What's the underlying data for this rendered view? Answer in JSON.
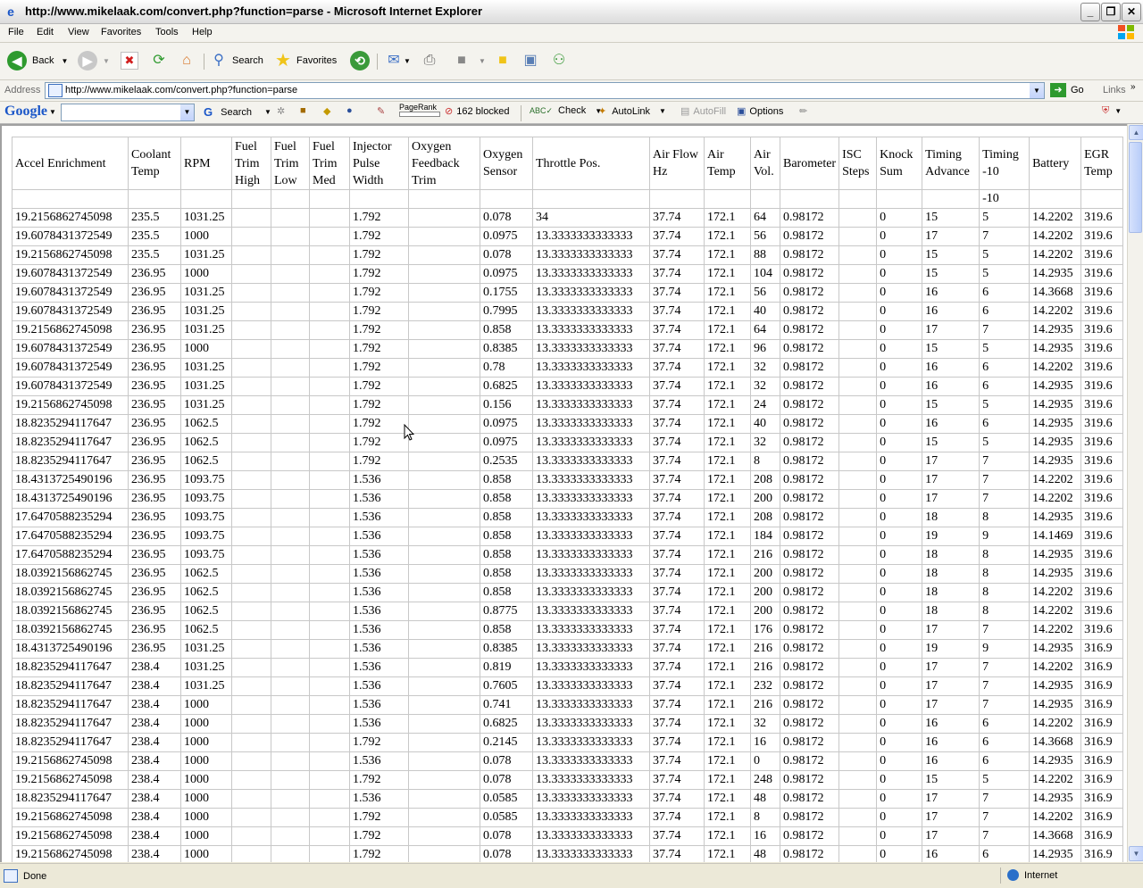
{
  "window": {
    "title": "http://www.mikelaak.com/convert.php?function=parse - Microsoft Internet Explorer"
  },
  "menu": [
    "File",
    "Edit",
    "View",
    "Favorites",
    "Tools",
    "Help"
  ],
  "toolbar": {
    "back": "Back",
    "search": "Search",
    "favorites": "Favorites"
  },
  "address": {
    "label": "Address",
    "url": "http://www.mikelaak.com/convert.php?function=parse",
    "go": "Go",
    "links": "Links"
  },
  "googlebar": {
    "brand": "Google",
    "search": "Search",
    "pagerank": "PageRank",
    "blocked": "162 blocked",
    "check": "Check",
    "autolink": "AutoLink",
    "autofill": "AutoFill",
    "options": "Options"
  },
  "status": {
    "text": "Done",
    "zone": "Internet"
  },
  "table": {
    "headers": [
      "Accel Enrichment",
      "Coolant Temp",
      "RPM",
      "Fuel Trim High",
      "Fuel Trim Low",
      "Fuel Trim Med",
      "Injector Pulse Width",
      "Oxygen Feedback Trim",
      "Oxygen Sensor",
      "Throttle Pos.",
      "Air Flow Hz",
      "Air Temp",
      "Air Vol.",
      "Barometer",
      "ISC Steps",
      "Knock Sum",
      "Timing Advance",
      "Timing -10",
      "Battery",
      "EGR Temp"
    ],
    "rows": [
      [
        "",
        "",
        "",
        "",
        "",
        "",
        "",
        "",
        "",
        "",
        "",
        "",
        "",
        "",
        "",
        "",
        "",
        "-10",
        "",
        ""
      ],
      [
        "19.2156862745098",
        "235.5",
        "1031.25",
        "",
        "",
        "",
        "1.792",
        "",
        "0.078",
        "34",
        "37.74",
        "172.1",
        "64",
        "0.98172",
        "",
        "0",
        "15",
        "5",
        "14.2202",
        "319.6"
      ],
      [
        "19.6078431372549",
        "235.5",
        "1000",
        "",
        "",
        "",
        "1.792",
        "",
        "0.0975",
        "13.3333333333333",
        "37.74",
        "172.1",
        "56",
        "0.98172",
        "",
        "0",
        "17",
        "7",
        "14.2202",
        "319.6"
      ],
      [
        "19.2156862745098",
        "235.5",
        "1031.25",
        "",
        "",
        "",
        "1.792",
        "",
        "0.078",
        "13.3333333333333",
        "37.74",
        "172.1",
        "88",
        "0.98172",
        "",
        "0",
        "15",
        "5",
        "14.2202",
        "319.6"
      ],
      [
        "19.6078431372549",
        "236.95",
        "1000",
        "",
        "",
        "",
        "1.792",
        "",
        "0.0975",
        "13.3333333333333",
        "37.74",
        "172.1",
        "104",
        "0.98172",
        "",
        "0",
        "15",
        "5",
        "14.2935",
        "319.6"
      ],
      [
        "19.6078431372549",
        "236.95",
        "1031.25",
        "",
        "",
        "",
        "1.792",
        "",
        "0.1755",
        "13.3333333333333",
        "37.74",
        "172.1",
        "56",
        "0.98172",
        "",
        "0",
        "16",
        "6",
        "14.3668",
        "319.6"
      ],
      [
        "19.6078431372549",
        "236.95",
        "1031.25",
        "",
        "",
        "",
        "1.792",
        "",
        "0.7995",
        "13.3333333333333",
        "37.74",
        "172.1",
        "40",
        "0.98172",
        "",
        "0",
        "16",
        "6",
        "14.2202",
        "319.6"
      ],
      [
        "19.2156862745098",
        "236.95",
        "1031.25",
        "",
        "",
        "",
        "1.792",
        "",
        "0.858",
        "13.3333333333333",
        "37.74",
        "172.1",
        "64",
        "0.98172",
        "",
        "0",
        "17",
        "7",
        "14.2935",
        "319.6"
      ],
      [
        "19.6078431372549",
        "236.95",
        "1000",
        "",
        "",
        "",
        "1.792",
        "",
        "0.8385",
        "13.3333333333333",
        "37.74",
        "172.1",
        "96",
        "0.98172",
        "",
        "0",
        "15",
        "5",
        "14.2935",
        "319.6"
      ],
      [
        "19.6078431372549",
        "236.95",
        "1031.25",
        "",
        "",
        "",
        "1.792",
        "",
        "0.78",
        "13.3333333333333",
        "37.74",
        "172.1",
        "32",
        "0.98172",
        "",
        "0",
        "16",
        "6",
        "14.2202",
        "319.6"
      ],
      [
        "19.6078431372549",
        "236.95",
        "1031.25",
        "",
        "",
        "",
        "1.792",
        "",
        "0.6825",
        "13.3333333333333",
        "37.74",
        "172.1",
        "32",
        "0.98172",
        "",
        "0",
        "16",
        "6",
        "14.2935",
        "319.6"
      ],
      [
        "19.2156862745098",
        "236.95",
        "1031.25",
        "",
        "",
        "",
        "1.792",
        "",
        "0.156",
        "13.3333333333333",
        "37.74",
        "172.1",
        "24",
        "0.98172",
        "",
        "0",
        "15",
        "5",
        "14.2935",
        "319.6"
      ],
      [
        "18.8235294117647",
        "236.95",
        "1062.5",
        "",
        "",
        "",
        "1.792",
        "",
        "0.0975",
        "13.3333333333333",
        "37.74",
        "172.1",
        "40",
        "0.98172",
        "",
        "0",
        "16",
        "6",
        "14.2935",
        "319.6"
      ],
      [
        "18.8235294117647",
        "236.95",
        "1062.5",
        "",
        "",
        "",
        "1.792",
        "",
        "0.0975",
        "13.3333333333333",
        "37.74",
        "172.1",
        "32",
        "0.98172",
        "",
        "0",
        "15",
        "5",
        "14.2935",
        "319.6"
      ],
      [
        "18.8235294117647",
        "236.95",
        "1062.5",
        "",
        "",
        "",
        "1.792",
        "",
        "0.2535",
        "13.3333333333333",
        "37.74",
        "172.1",
        "8",
        "0.98172",
        "",
        "0",
        "17",
        "7",
        "14.2935",
        "319.6"
      ],
      [
        "18.4313725490196",
        "236.95",
        "1093.75",
        "",
        "",
        "",
        "1.536",
        "",
        "0.858",
        "13.3333333333333",
        "37.74",
        "172.1",
        "208",
        "0.98172",
        "",
        "0",
        "17",
        "7",
        "14.2202",
        "319.6"
      ],
      [
        "18.4313725490196",
        "236.95",
        "1093.75",
        "",
        "",
        "",
        "1.536",
        "",
        "0.858",
        "13.3333333333333",
        "37.74",
        "172.1",
        "200",
        "0.98172",
        "",
        "0",
        "17",
        "7",
        "14.2202",
        "319.6"
      ],
      [
        "17.6470588235294",
        "236.95",
        "1093.75",
        "",
        "",
        "",
        "1.536",
        "",
        "0.858",
        "13.3333333333333",
        "37.74",
        "172.1",
        "208",
        "0.98172",
        "",
        "0",
        "18",
        "8",
        "14.2935",
        "319.6"
      ],
      [
        "17.6470588235294",
        "236.95",
        "1093.75",
        "",
        "",
        "",
        "1.536",
        "",
        "0.858",
        "13.3333333333333",
        "37.74",
        "172.1",
        "184",
        "0.98172",
        "",
        "0",
        "19",
        "9",
        "14.1469",
        "319.6"
      ],
      [
        "17.6470588235294",
        "236.95",
        "1093.75",
        "",
        "",
        "",
        "1.536",
        "",
        "0.858",
        "13.3333333333333",
        "37.74",
        "172.1",
        "216",
        "0.98172",
        "",
        "0",
        "18",
        "8",
        "14.2935",
        "319.6"
      ],
      [
        "18.0392156862745",
        "236.95",
        "1062.5",
        "",
        "",
        "",
        "1.536",
        "",
        "0.858",
        "13.3333333333333",
        "37.74",
        "172.1",
        "200",
        "0.98172",
        "",
        "0",
        "18",
        "8",
        "14.2935",
        "319.6"
      ],
      [
        "18.0392156862745",
        "236.95",
        "1062.5",
        "",
        "",
        "",
        "1.536",
        "",
        "0.858",
        "13.3333333333333",
        "37.74",
        "172.1",
        "200",
        "0.98172",
        "",
        "0",
        "18",
        "8",
        "14.2202",
        "319.6"
      ],
      [
        "18.0392156862745",
        "236.95",
        "1062.5",
        "",
        "",
        "",
        "1.536",
        "",
        "0.8775",
        "13.3333333333333",
        "37.74",
        "172.1",
        "200",
        "0.98172",
        "",
        "0",
        "18",
        "8",
        "14.2202",
        "319.6"
      ],
      [
        "18.0392156862745",
        "236.95",
        "1062.5",
        "",
        "",
        "",
        "1.536",
        "",
        "0.858",
        "13.3333333333333",
        "37.74",
        "172.1",
        "176",
        "0.98172",
        "",
        "0",
        "17",
        "7",
        "14.2202",
        "319.6"
      ],
      [
        "18.4313725490196",
        "236.95",
        "1031.25",
        "",
        "",
        "",
        "1.536",
        "",
        "0.8385",
        "13.3333333333333",
        "37.74",
        "172.1",
        "216",
        "0.98172",
        "",
        "0",
        "19",
        "9",
        "14.2935",
        "316.9"
      ],
      [
        "18.8235294117647",
        "238.4",
        "1031.25",
        "",
        "",
        "",
        "1.536",
        "",
        "0.819",
        "13.3333333333333",
        "37.74",
        "172.1",
        "216",
        "0.98172",
        "",
        "0",
        "17",
        "7",
        "14.2202",
        "316.9"
      ],
      [
        "18.8235294117647",
        "238.4",
        "1031.25",
        "",
        "",
        "",
        "1.536",
        "",
        "0.7605",
        "13.3333333333333",
        "37.74",
        "172.1",
        "232",
        "0.98172",
        "",
        "0",
        "17",
        "7",
        "14.2935",
        "316.9"
      ],
      [
        "18.8235294117647",
        "238.4",
        "1000",
        "",
        "",
        "",
        "1.536",
        "",
        "0.741",
        "13.3333333333333",
        "37.74",
        "172.1",
        "216",
        "0.98172",
        "",
        "0",
        "17",
        "7",
        "14.2935",
        "316.9"
      ],
      [
        "18.8235294117647",
        "238.4",
        "1000",
        "",
        "",
        "",
        "1.536",
        "",
        "0.6825",
        "13.3333333333333",
        "37.74",
        "172.1",
        "32",
        "0.98172",
        "",
        "0",
        "16",
        "6",
        "14.2202",
        "316.9"
      ],
      [
        "18.8235294117647",
        "238.4",
        "1000",
        "",
        "",
        "",
        "1.792",
        "",
        "0.2145",
        "13.3333333333333",
        "37.74",
        "172.1",
        "16",
        "0.98172",
        "",
        "0",
        "16",
        "6",
        "14.3668",
        "316.9"
      ],
      [
        "19.2156862745098",
        "238.4",
        "1000",
        "",
        "",
        "",
        "1.536",
        "",
        "0.078",
        "13.3333333333333",
        "37.74",
        "172.1",
        "0",
        "0.98172",
        "",
        "0",
        "16",
        "6",
        "14.2935",
        "316.9"
      ],
      [
        "19.2156862745098",
        "238.4",
        "1000",
        "",
        "",
        "",
        "1.792",
        "",
        "0.078",
        "13.3333333333333",
        "37.74",
        "172.1",
        "248",
        "0.98172",
        "",
        "0",
        "15",
        "5",
        "14.2202",
        "316.9"
      ],
      [
        "18.8235294117647",
        "238.4",
        "1000",
        "",
        "",
        "",
        "1.536",
        "",
        "0.0585",
        "13.3333333333333",
        "37.74",
        "172.1",
        "48",
        "0.98172",
        "",
        "0",
        "17",
        "7",
        "14.2935",
        "316.9"
      ],
      [
        "19.2156862745098",
        "238.4",
        "1000",
        "",
        "",
        "",
        "1.792",
        "",
        "0.0585",
        "13.3333333333333",
        "37.74",
        "172.1",
        "8",
        "0.98172",
        "",
        "0",
        "17",
        "7",
        "14.2202",
        "316.9"
      ],
      [
        "19.2156862745098",
        "238.4",
        "1000",
        "",
        "",
        "",
        "1.792",
        "",
        "0.078",
        "13.3333333333333",
        "37.74",
        "172.1",
        "16",
        "0.98172",
        "",
        "0",
        "17",
        "7",
        "14.3668",
        "316.9"
      ],
      [
        "19.2156862745098",
        "238.4",
        "1000",
        "",
        "",
        "",
        "1.792",
        "",
        "0.078",
        "13.3333333333333",
        "37.74",
        "172.1",
        "48",
        "0.98172",
        "",
        "0",
        "16",
        "6",
        "14.2935",
        "316.9"
      ]
    ]
  }
}
